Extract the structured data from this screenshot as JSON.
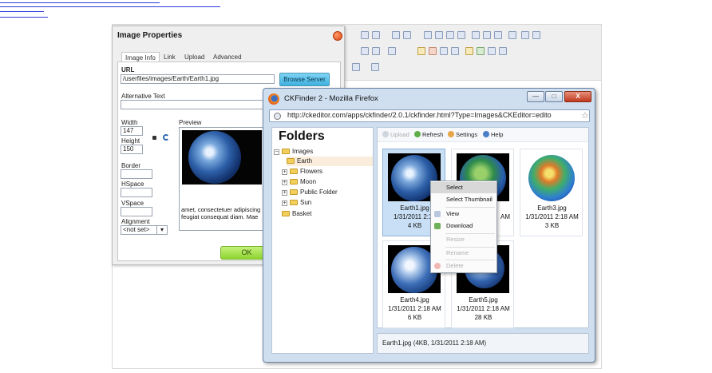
{
  "dialog": {
    "title": "Image Properties",
    "tabs": [
      "Image Info",
      "Link",
      "Upload",
      "Advanced"
    ],
    "url_label": "URL",
    "url_value": "/userfiles/images/Earth/Earth1.jpg",
    "browse_label": "Browse Server",
    "alt_label": "Alternative Text",
    "alt_value": "",
    "width_label": "Width",
    "width_value": "147",
    "height_label": "Height",
    "height_value": "150",
    "border_label": "Border",
    "hspace_label": "HSpace",
    "vspace_label": "VSpace",
    "alignment_label": "Alignment",
    "alignment_value": "<not set>",
    "preview_label": "Preview",
    "preview_text": "amet, consectetuer adipiscing feugiat consequat diam. Mae",
    "ok_label": "OK"
  },
  "browser": {
    "title": "CKFinder 2 - Mozilla Firefox",
    "url": "http://ckeditor.com/apps/ckfinder/2.0.1/ckfinder.html?Type=Images&CKEditor=edito",
    "minimize": "—",
    "maximize": "□",
    "close": "X"
  },
  "folders": {
    "title": "Folders",
    "tree": [
      {
        "label": "Images",
        "expander": "−"
      },
      {
        "label": "Earth",
        "expander": ""
      },
      {
        "label": "Flowers",
        "expander": "+"
      },
      {
        "label": "Moon",
        "expander": "+"
      },
      {
        "label": "Public Folder",
        "expander": "+"
      },
      {
        "label": "Sun",
        "expander": "+"
      },
      {
        "label": "Basket",
        "expander": ""
      }
    ]
  },
  "toolbar": {
    "upload": "Upload",
    "refresh": "Refresh",
    "settings": "Settings",
    "help": "Help"
  },
  "files": [
    {
      "name": "Earth1.jpg",
      "date": "1/31/2011 2:18",
      "size": "4 KB"
    },
    {
      "name": "",
      "date": "AM",
      "size": ""
    },
    {
      "name": "Earth3.jpg",
      "date": "1/31/2011 2:18 AM",
      "size": "3 KB"
    },
    {
      "name": "Earth4.jpg",
      "date": "1/31/2011 2:18 AM",
      "size": "6 KB"
    },
    {
      "name": "Earth5.jpg",
      "date": "1/31/2011 2:18 AM",
      "size": "28 KB"
    }
  ],
  "status": "Earth1.jpg (4KB, 1/31/2011 2:18 AM)",
  "context_menu": [
    {
      "label": "Select"
    },
    {
      "label": "Select Thumbnail"
    },
    {
      "label": "View"
    },
    {
      "label": "Download"
    },
    {
      "label": "Resize"
    },
    {
      "label": "Rename"
    },
    {
      "label": "Delete"
    }
  ],
  "colors": {
    "link_underline": "#2a3bd8",
    "selection": "#c9dff5",
    "ok_green": "#8ed431",
    "browse_blue": "#3fb1e0"
  },
  "icons": [
    "firefox-icon",
    "close-icon",
    "folder-icon",
    "refresh-icon",
    "lock-icon",
    "star-icon",
    "upload-icon",
    "settings-icon",
    "help-icon",
    "view-icon",
    "download-icon",
    "delete-icon"
  ]
}
